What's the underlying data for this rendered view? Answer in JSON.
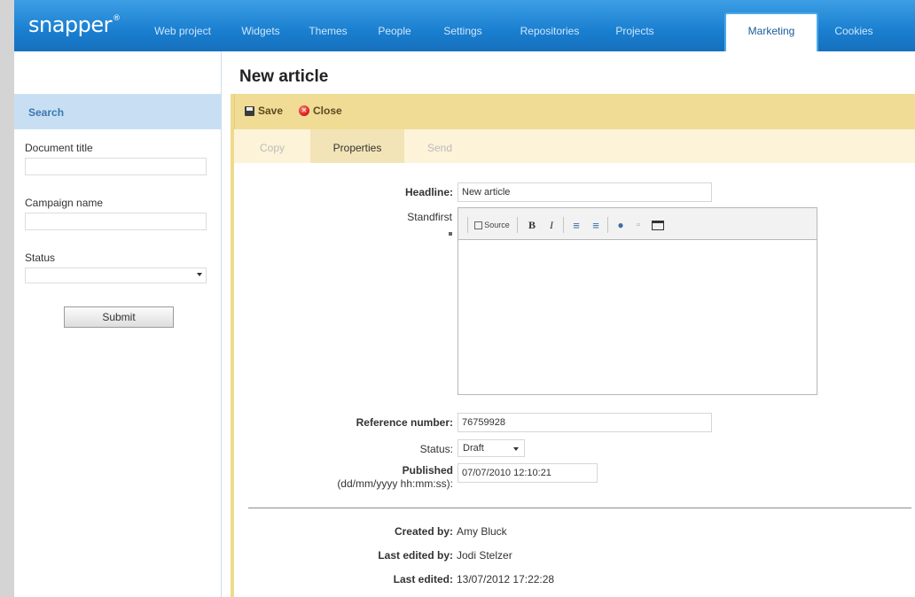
{
  "app": {
    "logo": "snapper",
    "logo_mark": "®"
  },
  "nav": {
    "tabs": [
      {
        "label": "Web project"
      },
      {
        "label": "Widgets"
      },
      {
        "label": "Themes"
      },
      {
        "label": "People"
      },
      {
        "label": "Settings"
      },
      {
        "label": "Repositories"
      },
      {
        "label": "Projects"
      },
      {
        "label": "Marketing",
        "active": true
      },
      {
        "label": "Cookies"
      }
    ]
  },
  "search": {
    "header": "Search",
    "document_title_label": "Document title",
    "document_title_value": "",
    "campaign_name_label": "Campaign name",
    "campaign_name_value": "",
    "status_label": "Status",
    "status_value": "",
    "submit_label": "Submit"
  },
  "page": {
    "title": "New article"
  },
  "toolbar": {
    "save_label": "Save",
    "close_label": "Close"
  },
  "tabs": [
    {
      "label": "Copy",
      "active": false
    },
    {
      "label": "Properties",
      "active": true
    },
    {
      "label": "Send",
      "active": false
    }
  ],
  "form": {
    "headline_label": "Headline:",
    "headline_value": "New article",
    "standfirst_label": "Standfirst",
    "editor_source_label": "Source",
    "reference_label": "Reference number:",
    "reference_value": "76759928",
    "status_label": "Status:",
    "status_value": "Draft",
    "published_label": "Published",
    "published_format": "(dd/mm/yyyy hh:mm:ss):",
    "published_value": "07/07/2010 12:10:21"
  },
  "meta": {
    "created_by_label": "Created by:",
    "created_by_value": "Amy Bluck",
    "last_edited_by_label": "Last edited by:",
    "last_edited_by_value": "Jodi Stelzer",
    "last_edited_label": "Last edited:",
    "last_edited_value": "13/07/2012 17:22:28"
  },
  "colors": {
    "nav_blue": "#1a7fd0",
    "search_header": "#c8dff3",
    "toolbar_gold": "#f1dc96",
    "tab_active": "#f2e4b6"
  },
  "icons": {
    "save": "floppy-disk-icon",
    "close": "close-circle-icon"
  }
}
